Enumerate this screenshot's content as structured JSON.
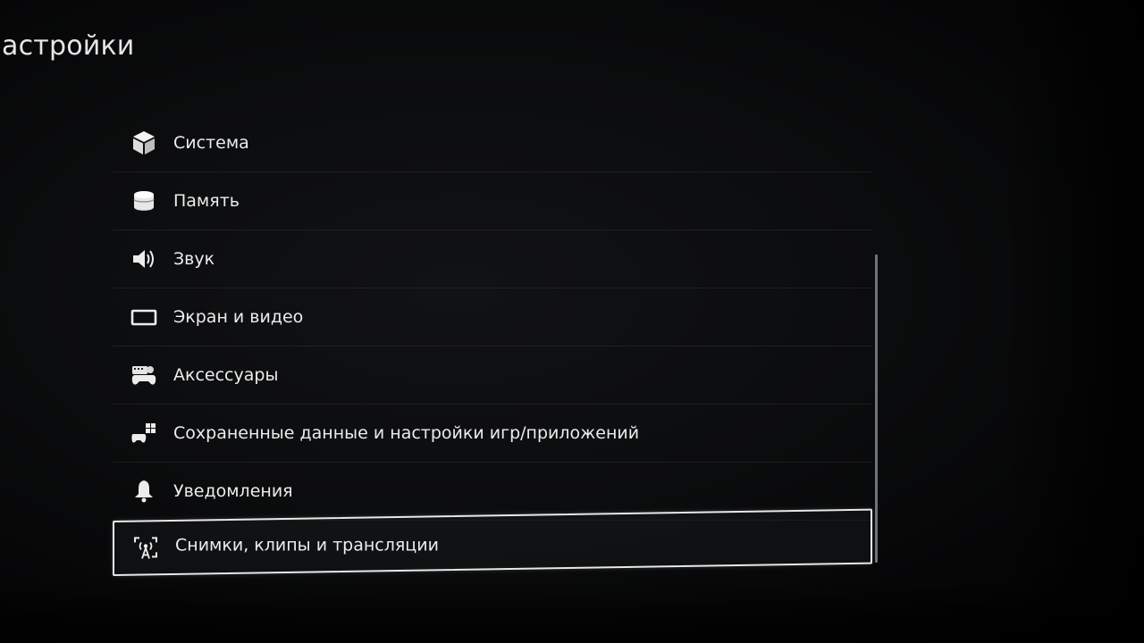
{
  "page": {
    "title": "астройки"
  },
  "menu": {
    "items": [
      {
        "label": "Система",
        "icon": "cube-icon"
      },
      {
        "label": "Память",
        "icon": "storage-cylinder-icon"
      },
      {
        "label": "Звук",
        "icon": "speaker-icon"
      },
      {
        "label": "Экран и видео",
        "icon": "display-icon"
      },
      {
        "label": "Аксессуары",
        "icon": "accessories-icon"
      },
      {
        "label": "Сохраненные данные и настройки игр/приложений",
        "icon": "saved-data-icon"
      },
      {
        "label": "Уведомления",
        "icon": "bell-icon"
      },
      {
        "label": "Снимки, клипы и трансляции",
        "icon": "capture-broadcast-icon",
        "selected": true
      }
    ]
  },
  "colors": {
    "background": "#0b0c0d",
    "text": "#ececec",
    "selection_border": "#e8e8e8",
    "scrollbar": "#6f747a"
  }
}
